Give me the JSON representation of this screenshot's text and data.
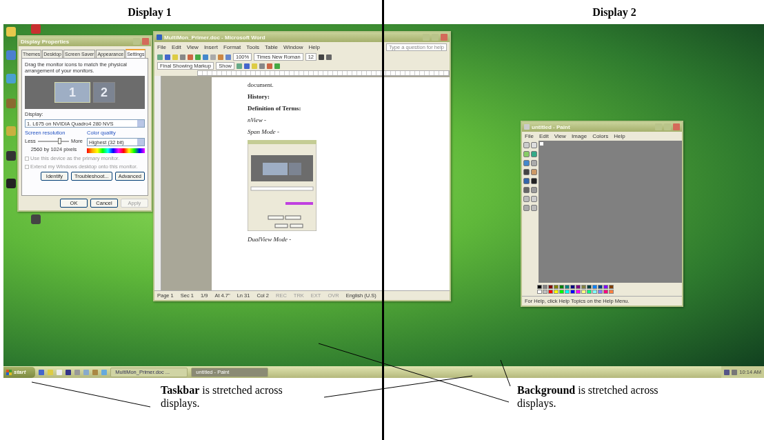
{
  "headings": [
    "Display 1",
    "Display 2"
  ],
  "display_properties": {
    "title": "Display Properties",
    "tabs": [
      {
        "label": "Themes",
        "selected": false
      },
      {
        "label": "Desktop",
        "selected": false
      },
      {
        "label": "Screen Saver",
        "selected": false
      },
      {
        "label": "Appearance",
        "selected": false
      },
      {
        "label": "Settings",
        "selected": true
      }
    ],
    "instruction": "Drag the monitor icons to match the physical arrangement of your monitors.",
    "monitors": [
      {
        "label": "1",
        "selected": true
      },
      {
        "label": "2",
        "selected": false
      }
    ],
    "display_label": "Display:",
    "display_value": "1. L675 on NVIDIA Quadro4 280 NVS",
    "resolution": {
      "label": "Screen resolution",
      "less": "Less",
      "more": "More",
      "level": 0.7,
      "reading": "2560 by 1024 pixels"
    },
    "color_quality": {
      "label": "Color quality",
      "value": "Highest (32 bit)"
    },
    "options": [
      {
        "label": "Use this device as the primary monitor.",
        "checked": false,
        "disabled": true
      },
      {
        "label": "Extend my Windows desktop onto this monitor.",
        "checked": false,
        "disabled": true
      }
    ],
    "buttons": [
      {
        "label": "Identify",
        "disabled": false
      },
      {
        "label": "Troubleshoot...",
        "disabled": false
      },
      {
        "label": "Advanced",
        "disabled": false
      }
    ],
    "footer_buttons": [
      {
        "label": "OK",
        "disabled": false
      },
      {
        "label": "Cancel",
        "disabled": false
      },
      {
        "label": "Apply",
        "disabled": true
      }
    ]
  },
  "word": {
    "title": "MultiMon_Primer.doc - Microsoft Word",
    "menu": [
      "File",
      "Edit",
      "View",
      "Insert",
      "Format",
      "Tools",
      "Table",
      "Window",
      "Help"
    ],
    "help_placeholder": "Type a question for help",
    "zoom": "100%",
    "font": "Times New Roman",
    "size": "12",
    "markup": "Final Showing Markup",
    "show": "Show",
    "paragraphs": [
      {
        "kind": "text",
        "text": "document."
      },
      {
        "kind": "heading",
        "text": "History:"
      },
      {
        "kind": "heading",
        "text": "Definition of Terms:"
      },
      {
        "kind": "term",
        "text": "nView -"
      },
      {
        "kind": "term",
        "text": "Span Mode -"
      },
      {
        "kind": "figure"
      },
      {
        "kind": "term",
        "text": "DualView Mode -"
      }
    ],
    "status": [
      "Page 1",
      "Sec 1",
      "1/9",
      "At 4.7\"",
      "Ln 31",
      "Col 2",
      "REC",
      "TRK",
      "EXT",
      "OVR",
      "English (U.S)"
    ]
  },
  "paint": {
    "title": "untitled - Paint",
    "menu": [
      "File",
      "Edit",
      "View",
      "Image",
      "Colors",
      "Help"
    ],
    "status": "For Help, click Help Topics on the Help Menu."
  },
  "taskbar": {
    "start": "start",
    "tasks": [
      {
        "label": "MultiMon_Primer.doc ...",
        "selected": false
      },
      {
        "label": "untitled - Paint",
        "selected": true
      }
    ],
    "clock": "10:14 AM"
  },
  "annotations": [
    "**Taskbar** is stretched across displays.",
    "**Background** is stretched across displays."
  ]
}
